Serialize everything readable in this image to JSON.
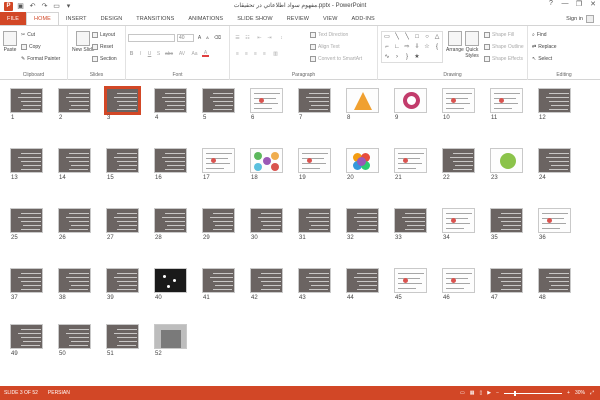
{
  "titlebar": {
    "app_logo_letter": "P",
    "title": "مفهوم سواد اطلاعاتي در تحقيقات.pptx - PowerPoint",
    "help": "?",
    "minimize": "—",
    "restore": "❐",
    "close": "✕"
  },
  "tabs": [
    "FILE",
    "HOME",
    "INSERT",
    "DESIGN",
    "TRANSITIONS",
    "ANIMATIONS",
    "SLIDE SHOW",
    "REVIEW",
    "VIEW",
    "ADD-INS"
  ],
  "active_tab": "HOME",
  "sign_in": "Sign in",
  "ribbon": {
    "clipboard": {
      "label": "Clipboard",
      "paste": "Paste",
      "cut": "Cut",
      "copy": "Copy",
      "format_painter": "Format Painter"
    },
    "slides": {
      "label": "Slides",
      "new_slide": "New Slide",
      "layout": "Layout",
      "reset": "Reset",
      "section": "Section"
    },
    "font": {
      "label": "Font",
      "size": "40",
      "bold": "B",
      "italic": "I",
      "underline": "U",
      "strike": "S",
      "shadow": "abc",
      "spacing": "AV",
      "case": "Aa",
      "color": "A",
      "grow": "A",
      "shrink": "A"
    },
    "paragraph": {
      "label": "Paragraph",
      "text_direction": "Text Direction",
      "align_text": "Align Text",
      "convert_smartart": "Convert to SmartArt"
    },
    "drawing": {
      "label": "Drawing",
      "arrange": "Arrange",
      "quick_styles": "Quick Styles",
      "shape_fill": "Shape Fill",
      "shape_outline": "Shape Outline",
      "shape_effects": "Shape Effects"
    },
    "editing": {
      "label": "Editing",
      "find": "Find",
      "replace": "Replace",
      "select": "Select"
    }
  },
  "slides": [
    {
      "n": "1"
    },
    {
      "n": "2"
    },
    {
      "n": "3"
    },
    {
      "n": "4"
    },
    {
      "n": "5"
    },
    {
      "n": "6"
    },
    {
      "n": "7"
    },
    {
      "n": "8"
    },
    {
      "n": "9"
    },
    {
      "n": "10"
    },
    {
      "n": "11"
    },
    {
      "n": "12"
    },
    {
      "n": "13"
    },
    {
      "n": "14"
    },
    {
      "n": "15"
    },
    {
      "n": "16"
    },
    {
      "n": "17"
    },
    {
      "n": "18"
    },
    {
      "n": "19"
    },
    {
      "n": "20"
    },
    {
      "n": "21"
    },
    {
      "n": "22"
    },
    {
      "n": "23"
    },
    {
      "n": "24"
    },
    {
      "n": "25"
    },
    {
      "n": "26"
    },
    {
      "n": "27"
    },
    {
      "n": "28"
    },
    {
      "n": "29"
    },
    {
      "n": "30"
    },
    {
      "n": "31"
    },
    {
      "n": "32"
    },
    {
      "n": "33"
    },
    {
      "n": "34"
    },
    {
      "n": "35"
    },
    {
      "n": "36"
    },
    {
      "n": "37"
    },
    {
      "n": "38"
    },
    {
      "n": "39"
    },
    {
      "n": "40"
    },
    {
      "n": "41"
    },
    {
      "n": "42"
    },
    {
      "n": "43"
    },
    {
      "n": "44"
    },
    {
      "n": "45"
    },
    {
      "n": "46"
    },
    {
      "n": "47"
    },
    {
      "n": "48"
    },
    {
      "n": "49"
    },
    {
      "n": "50"
    },
    {
      "n": "51"
    },
    {
      "n": "52"
    }
  ],
  "selected_slide": "3",
  "status": {
    "slide_info": "SLIDE 3 OF 52",
    "language": "PERSIAN",
    "zoom": "30%",
    "zoom_minus": "−",
    "zoom_plus": "+"
  },
  "colors": {
    "accent": "#d24726",
    "slide_bg": "#6b6462"
  }
}
